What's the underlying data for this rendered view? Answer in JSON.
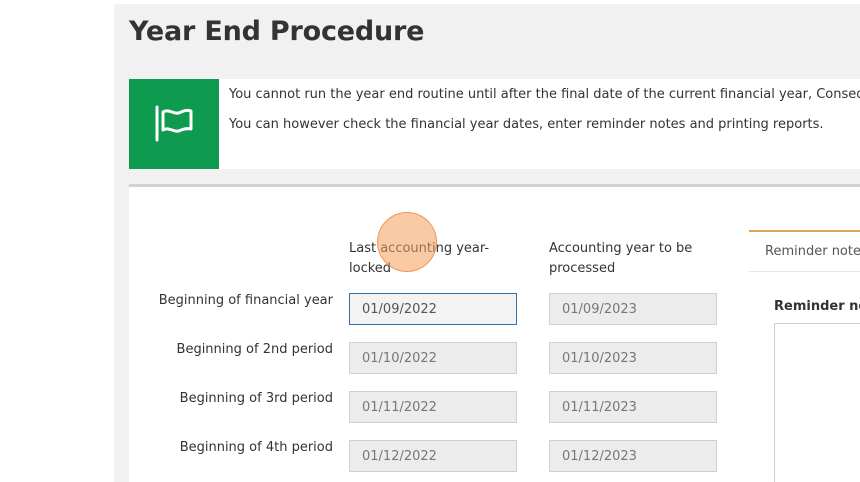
{
  "page": {
    "title": "Year End Procedure"
  },
  "notice": {
    "icon": "flag-icon",
    "icon_bg": "#0e9a4f",
    "line1": "You cannot run the year end routine until after the final date of the current financial year, Consequen",
    "line2": "You can however check the financial year dates, enter reminder notes and printing reports."
  },
  "columns": {
    "last_locked": "Last accounting year-locked",
    "to_process": "Accounting year to be processed"
  },
  "rows": [
    {
      "label": "Beginning of financial year",
      "last_locked": "01/09/2022",
      "to_process": "01/09/2023"
    },
    {
      "label": "Beginning of 2nd period",
      "last_locked": "01/10/2022",
      "to_process": "01/10/2023"
    },
    {
      "label": "Beginning of 3rd period",
      "last_locked": "01/11/2022",
      "to_process": "01/11/2023"
    },
    {
      "label": "Beginning of 4th period",
      "last_locked": "01/12/2022",
      "to_process": "01/12/2023"
    }
  ],
  "reminder": {
    "tab_label": "Reminder note",
    "field_label": "Reminder not"
  },
  "colors": {
    "accent_green": "#0e9a4f",
    "tab_accent": "#e0a060",
    "focus_border": "#3a6ea5"
  }
}
